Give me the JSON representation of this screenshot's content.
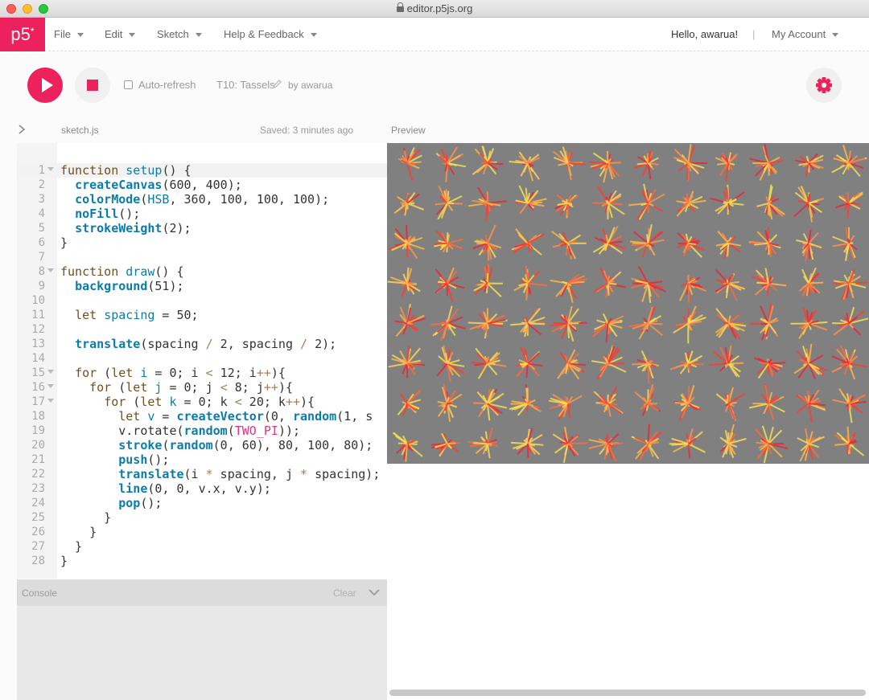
{
  "window": {
    "url": "editor.p5js.org"
  },
  "nav": {
    "logo": "p5",
    "logo_sup": "*",
    "menus": [
      "File",
      "Edit",
      "Sketch",
      "Help & Feedback"
    ],
    "greeting": "Hello, awarua!",
    "separator": "|",
    "account": "My Account"
  },
  "toolbar": {
    "auto_refresh_label": "Auto-refresh",
    "auto_refresh_checked": false,
    "sketch_name": "T10: Tassels",
    "byline": "by awarua",
    "icons": [
      "play-icon",
      "stop-icon",
      "pencil-icon",
      "gear-icon"
    ]
  },
  "filebar": {
    "filename": "sketch.js",
    "saved": "Saved: 3 minutes ago",
    "preview_label": "Preview"
  },
  "editor": {
    "active_line": 1,
    "lines": [
      {
        "n": "1",
        "fold": true,
        "html": "<span class='kw'>function</span> <span class='fn'>setup</span>() {"
      },
      {
        "n": "2",
        "fold": false,
        "html": "  <span class='bi'>createCanvas</span>(600, 400);"
      },
      {
        "n": "3",
        "fold": false,
        "html": "  <span class='bi'>colorMode</span>(<span class='fn'>HSB</span>, 360, 100, 100, 100);"
      },
      {
        "n": "4",
        "fold": false,
        "html": "  <span class='bi'>noFill</span>();"
      },
      {
        "n": "5",
        "fold": false,
        "html": "  <span class='bi'>strokeWeight</span>(2);"
      },
      {
        "n": "6",
        "fold": false,
        "html": "}"
      },
      {
        "n": "7",
        "fold": false,
        "html": ""
      },
      {
        "n": "8",
        "fold": true,
        "html": "<span class='kw'>function</span> <span class='fn'>draw</span>() {"
      },
      {
        "n": "9",
        "fold": false,
        "html": "  <span class='bi'>background</span>(51);"
      },
      {
        "n": "10",
        "fold": false,
        "html": ""
      },
      {
        "n": "11",
        "fold": false,
        "html": "  <span class='kw'>let</span> <span class='fn'>spacing</span> = 50;"
      },
      {
        "n": "12",
        "fold": false,
        "html": ""
      },
      {
        "n": "13",
        "fold": false,
        "html": "  <span class='bi'>translate</span>(spacing <span class='op'>/</span> 2, spacing <span class='op'>/</span> 2);"
      },
      {
        "n": "14",
        "fold": false,
        "html": ""
      },
      {
        "n": "15",
        "fold": true,
        "html": "  <span class='kw'>for</span> (<span class='kw'>let</span> <span class='fn'>i</span> = 0; i <span class='op'>&lt;</span> 12; i<span class='op'>++</span>){"
      },
      {
        "n": "16",
        "fold": true,
        "html": "    <span class='kw'>for</span> (<span class='kw'>let</span> <span class='fn'>j</span> = 0; j <span class='op'>&lt;</span> 8; j<span class='op'>++</span>){"
      },
      {
        "n": "17",
        "fold": true,
        "html": "      <span class='kw'>for</span> (<span class='kw'>let</span> <span class='fn'>k</span> = 0; k <span class='op'>&lt;</span> 20; k<span class='op'>++</span>){"
      },
      {
        "n": "18",
        "fold": false,
        "html": "        <span class='kw'>let</span> <span class='fn'>v</span> = <span class='bi'>createVector</span>(0, <span class='bi'>random</span>(1, s"
      },
      {
        "n": "19",
        "fold": false,
        "html": "        v.rotate(<span class='bi'>random</span>(<span class='cst'>TWO_PI</span>));"
      },
      {
        "n": "20",
        "fold": false,
        "html": "        <span class='bi'>stroke</span>(<span class='bi'>random</span>(0, 60), 80, 100, 80);"
      },
      {
        "n": "21",
        "fold": false,
        "html": "        <span class='bi'>push</span>();"
      },
      {
        "n": "22",
        "fold": false,
        "html": "        <span class='bi'>translate</span>(i <span class='op'>*</span> spacing, j <span class='op'>*</span> spacing);"
      },
      {
        "n": "23",
        "fold": false,
        "html": "        <span class='bi'>line</span>(0, 0, v.x, v.y);"
      },
      {
        "n": "24",
        "fold": false,
        "html": "        <span class='bi'>pop</span>();"
      },
      {
        "n": "25",
        "fold": false,
        "html": "      }"
      },
      {
        "n": "26",
        "fold": false,
        "html": "    }"
      },
      {
        "n": "27",
        "fold": false,
        "html": "  }"
      },
      {
        "n": "28",
        "fold": false,
        "html": "}"
      }
    ]
  },
  "console": {
    "title": "Console",
    "clear": "Clear"
  },
  "preview": {
    "background": "#808080",
    "cols": 12,
    "rows": 8,
    "strokes_per_tassel": 20,
    "palette": [
      "#ff3b2e",
      "#ff6b3a",
      "#ff8f4a",
      "#ffb545",
      "#ffd35a",
      "#f2e24d",
      "#e8283a"
    ]
  }
}
